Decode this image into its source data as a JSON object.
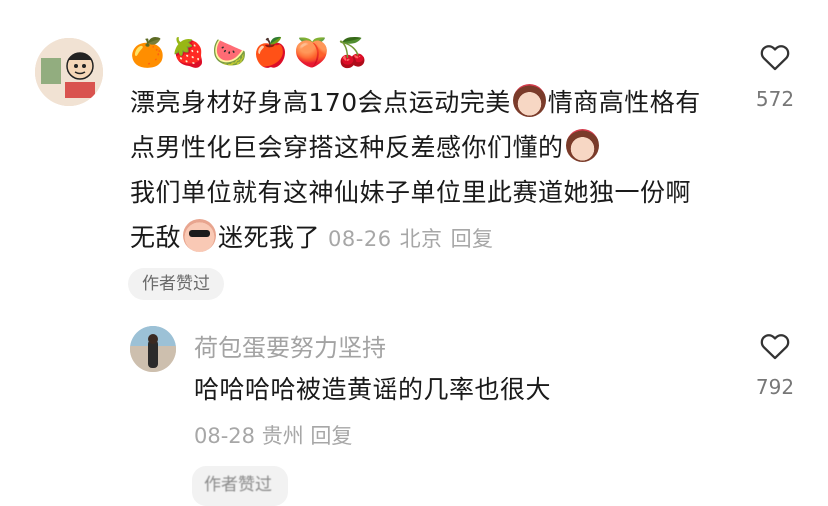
{
  "comment": {
    "emoji_row": [
      "🍊",
      "🍓",
      "🍉",
      "🍎",
      "🍑",
      "🍒"
    ],
    "text_part1": "漂亮身材好身高170会点运动完美",
    "text_part2": "情商高性格有点男性化巨会穿搭这种反差感你们懂的",
    "text_part3": "我们单位就有这神仙妹子单位里此赛道她独一份啊无敌",
    "text_part4": "迷死我了",
    "date": "08-26",
    "location": "北京",
    "reply_label": "回复",
    "like_count": "572",
    "author_badge": "作者赞过"
  },
  "reply": {
    "username": "荷包蛋要努力坚持",
    "text": "哈哈哈哈被造黄谣的几率也很大",
    "date": "08-28",
    "location": "贵州",
    "reply_label": "回复",
    "like_count": "792",
    "badge_partial": "作者赞过"
  },
  "icons": {
    "like": "heart-outline-icon"
  },
  "colors": {
    "text_primary": "#1a1a1a",
    "text_meta": "#a7a7a7",
    "badge_bg": "#f2f2f2"
  }
}
